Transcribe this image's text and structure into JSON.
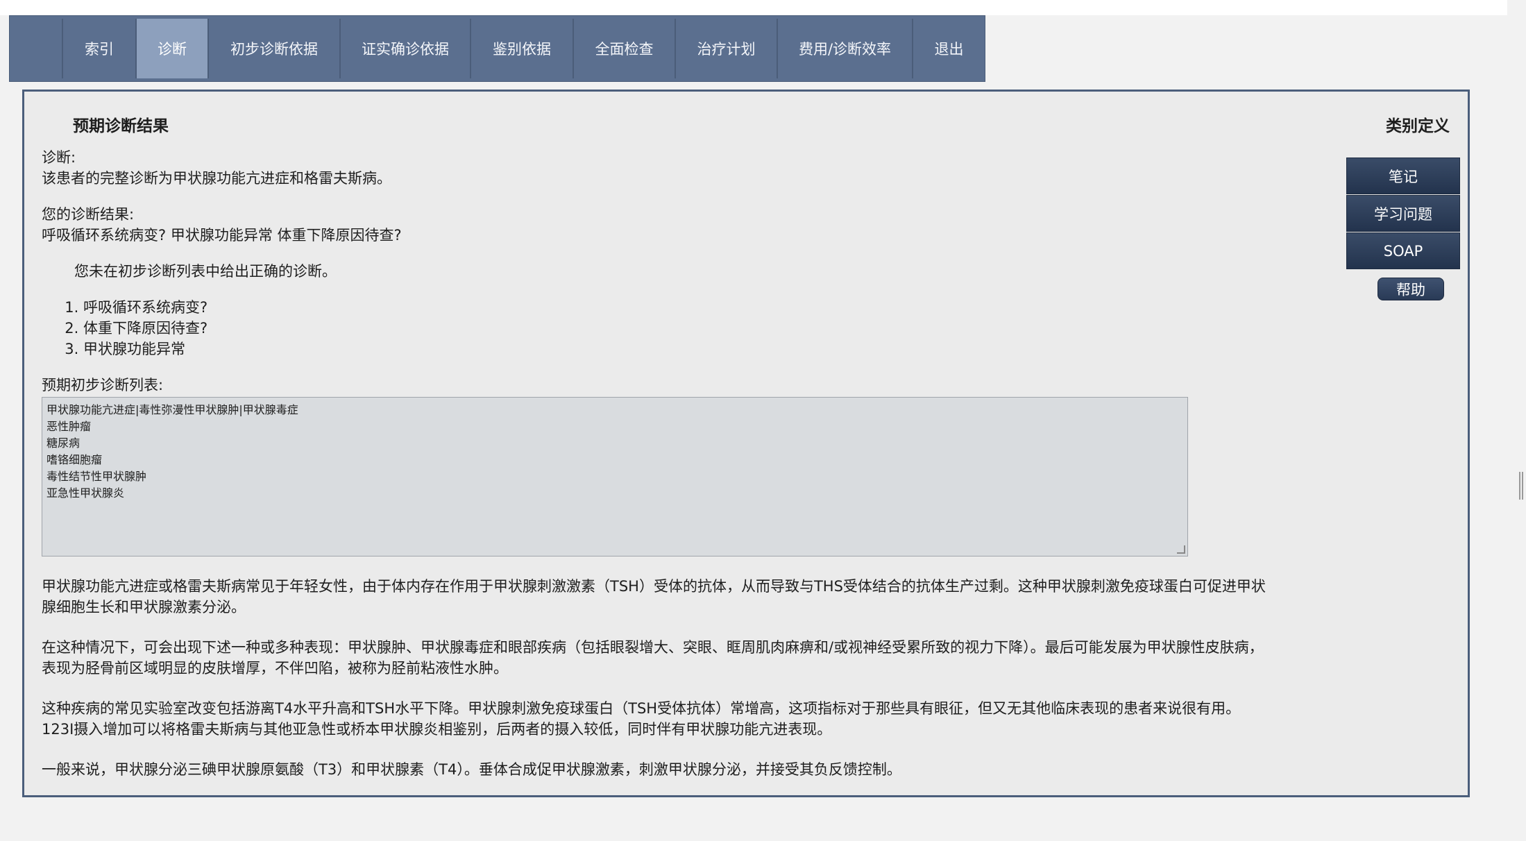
{
  "nav": {
    "items": [
      {
        "label": "索引",
        "active": false
      },
      {
        "label": "诊断",
        "active": true
      },
      {
        "label": "初步诊断依据",
        "active": false
      },
      {
        "label": "证实确诊依据",
        "active": false
      },
      {
        "label": "鉴别依据",
        "active": false
      },
      {
        "label": "全面检查",
        "active": false
      },
      {
        "label": "治疗计划",
        "active": false
      },
      {
        "label": "费用/诊断效率",
        "active": false
      },
      {
        "label": "退出",
        "active": false
      }
    ]
  },
  "panel": {
    "title": "预期诊断结果",
    "category_link": "类别定义",
    "diagnosis_label": "诊断:",
    "diagnosis_text": "该患者的完整诊断为甲状腺功能亢进症和格雷夫斯病。",
    "your_result_label": "您的诊断结果:",
    "your_result_text": "呼吸循环系统病变?  甲状腺功能异常 体重下降原因待查?",
    "note": "您未在初步诊断列表中给出正确的诊断。",
    "user_list": [
      "呼吸循环系统病变?",
      "体重下降原因待查?",
      "甲状腺功能异常"
    ],
    "expected_list_label": "预期初步诊断列表:",
    "expected_list": [
      "甲状腺功能亢进症|毒性弥漫性甲状腺肿|甲状腺毒症",
      "恶性肿瘤",
      "糖尿病",
      "嗜铬细胞瘤",
      "毒性结节性甲状腺肿",
      "亚急性甲状腺炎"
    ],
    "paragraphs": [
      "甲状腺功能亢进症或格雷夫斯病常见于年轻女性，由于体内存在作用于甲状腺刺激激素（TSH）受体的抗体，从而导致与THS受体结合的抗体生产过剩。这种甲状腺刺激免疫球蛋白可促进甲状腺细胞生长和甲状腺激素分泌。",
      "在这种情况下，可会出现下述一种或多种表现：甲状腺肿、甲状腺毒症和眼部疾病（包括眼裂增大、突眼、眶周肌肉麻痹和/或视神经受累所致的视力下降）。最后可能发展为甲状腺性皮肤病，表现为胫骨前区域明显的皮肤增厚，不伴凹陷，被称为胫前粘液性水肿。",
      "这种疾病的常见实验室改变包括游离T4水平升高和TSH水平下降。甲状腺刺激免疫球蛋白（TSH受体抗体）常增高，这项指标对于那些具有眼征，但又无其他临床表现的患者来说很有用。123I摄入增加可以将格雷夫斯病与其他亚急性或桥本甲状腺炎相鉴别，后两者的摄入较低，同时伴有甲状腺功能亢进表现。",
      "一般来说，甲状腺分泌三碘甲状腺原氨酸（T3）和甲状腺素（T4）。垂体合成促甲状腺激素，刺激甲状腺分泌，并接受其负反馈控制。"
    ]
  },
  "side_menu": {
    "notes": "笔记",
    "study_questions": "学习问题",
    "soap": "SOAP",
    "help": "帮助"
  }
}
